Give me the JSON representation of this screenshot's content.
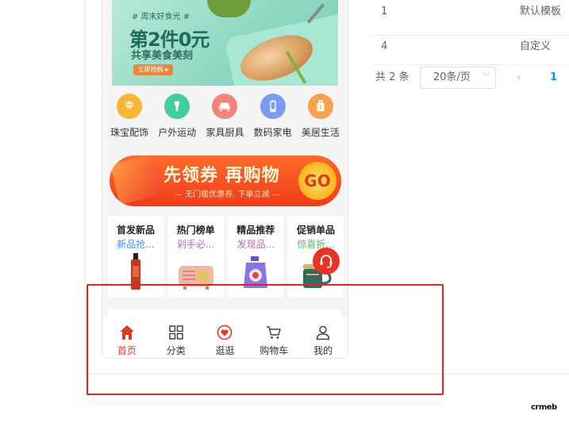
{
  "banner": {
    "tag": "# 周末好食光 #",
    "headline": "第2件0元",
    "subline": "共享美食美刻",
    "cta": "立即抢购 ▸"
  },
  "categories": [
    {
      "label": "珠宝配饰",
      "color": "#f7b733",
      "icon": "gem-icon"
    },
    {
      "label": "户外运动",
      "color": "#3fcf9a",
      "icon": "badminton-icon"
    },
    {
      "label": "家具厨具",
      "color": "#f5837a",
      "icon": "sofa-icon"
    },
    {
      "label": "数码家电",
      "color": "#7b9bf5",
      "icon": "phone-icon"
    },
    {
      "label": "美居生活",
      "color": "#f7a24a",
      "icon": "luggage-icon"
    }
  ],
  "coupon": {
    "title": "先领券 再购物",
    "note": "— 无门槛优惠券, 下单立减 —",
    "go": "GO"
  },
  "cards": [
    {
      "title": "首发新品",
      "subtitle": "新品抢...",
      "color": "#4a90e2"
    },
    {
      "title": "热门榜单",
      "subtitle": "剁手必...",
      "color": "#c066c8"
    },
    {
      "title": "精品推荐",
      "subtitle": "发现品...",
      "color": "#c066c8"
    },
    {
      "title": "促销单品",
      "subtitle": "惊喜折...",
      "color": "#5ab56a"
    }
  ],
  "tabbar": [
    {
      "label": "首页",
      "icon": "home-icon",
      "active": true
    },
    {
      "label": "分类",
      "icon": "grid-icon",
      "active": false
    },
    {
      "label": "逛逛",
      "icon": "heart-circle-icon",
      "active": false
    },
    {
      "label": "购物车",
      "icon": "cart-icon",
      "active": false
    },
    {
      "label": "我的",
      "icon": "user-icon",
      "active": false
    }
  ],
  "table": {
    "rows": [
      {
        "id": "1",
        "type": "默认模板"
      },
      {
        "id": "4",
        "type": "自定义"
      }
    ]
  },
  "pagination": {
    "total": "共 2 条",
    "page_size": "20条/页",
    "current": "1"
  },
  "brand": "crmeb",
  "accent": "#e93323",
  "highlight_color": "#e1251b"
}
